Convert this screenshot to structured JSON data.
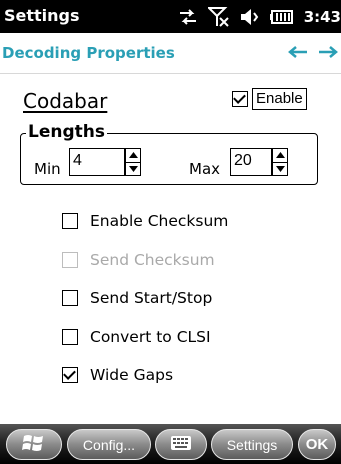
{
  "status_bar": {
    "title": "Settings",
    "time": "3:43",
    "icons": [
      "network-icon",
      "signal-icon",
      "volume-icon",
      "battery-icon"
    ]
  },
  "subheader": {
    "title": "Decoding Properties",
    "prev_icon": "arrow-left-icon",
    "next_icon": "arrow-right-icon"
  },
  "symbology": {
    "name": "Codabar",
    "enable_label": "Enable",
    "enabled": true
  },
  "lengths": {
    "legend": "Lengths",
    "min_label": "Min",
    "min_value": "4",
    "max_label": "Max",
    "max_value": "20"
  },
  "options": [
    {
      "label": "Enable Checksum",
      "checked": false,
      "disabled": false
    },
    {
      "label": "Send Checksum",
      "checked": false,
      "disabled": true
    },
    {
      "label": "Send Start/Stop",
      "checked": false,
      "disabled": false
    },
    {
      "label": "Convert to CLSI",
      "checked": false,
      "disabled": false
    },
    {
      "label": "Wide Gaps",
      "checked": true,
      "disabled": false
    }
  ],
  "taskbar": {
    "start_icon": "windows-start-icon",
    "config_label": "Config...",
    "keyboard_icon": "keyboard-icon",
    "settings_label": "Settings",
    "ok_label": "OK"
  },
  "colors": {
    "accent": "#2a9fb5",
    "disabled_text": "#a9a9a9"
  }
}
